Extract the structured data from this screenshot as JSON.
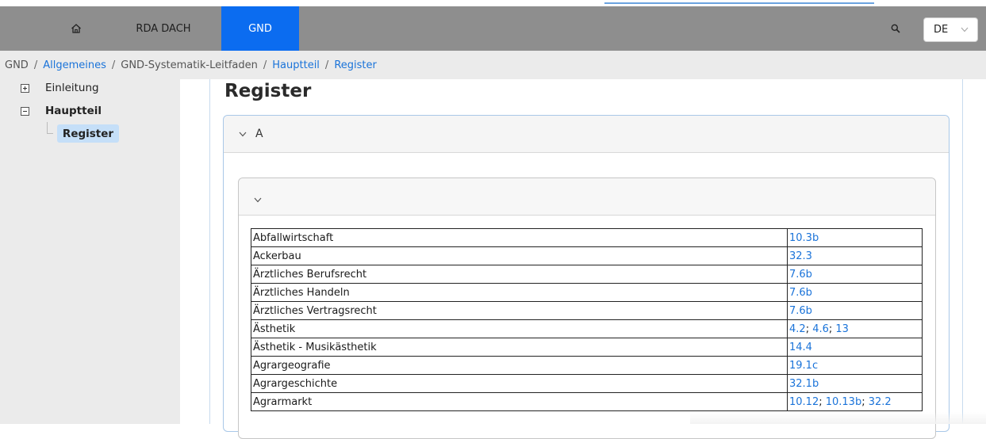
{
  "nav": {
    "home_icon": "home-icon",
    "items": [
      {
        "label": "RDA DACH"
      },
      {
        "label": "GND",
        "active": true
      }
    ],
    "search_icon": "search-icon",
    "language": "DE"
  },
  "breadcrumb": [
    "GND",
    "Allgemeines",
    "GND-Systematik-Leitfaden",
    "Hauptteil",
    "Register"
  ],
  "sidebar": {
    "items": [
      {
        "label": "Einleitung",
        "state": "collapsed"
      },
      {
        "label": "Hauptteil",
        "state": "expanded"
      },
      {
        "label": "Register",
        "active": true
      }
    ]
  },
  "main": {
    "title": "Register",
    "accordion_outer": {
      "label": "A"
    },
    "accordion_inner": {
      "label": ""
    },
    "rows": [
      {
        "term": "Abfallwirtschaft",
        "refs": [
          "10.3b"
        ]
      },
      {
        "term": "Ackerbau",
        "refs": [
          "32.3"
        ]
      },
      {
        "term": "Ärztliches Berufsrecht",
        "refs": [
          "7.6b"
        ]
      },
      {
        "term": "Ärztliches Handeln",
        "refs": [
          "7.6b"
        ]
      },
      {
        "term": "Ärztliches Vertragsrecht",
        "refs": [
          "7.6b"
        ]
      },
      {
        "term": "Ästhetik",
        "refs": [
          "4.2",
          "4.6",
          "13"
        ]
      },
      {
        "term": "Ästhetik - Musikästhetik",
        "refs": [
          "14.4"
        ]
      },
      {
        "term": "Agrargeografie",
        "refs": [
          "19.1c"
        ]
      },
      {
        "term": "Agrargeschichte",
        "refs": [
          "32.1b"
        ]
      },
      {
        "term": "Agrarmarkt",
        "refs": [
          "10.12",
          "10.13b",
          "32.2"
        ]
      }
    ]
  },
  "colors": {
    "nav_bg": "#8e8e8e",
    "nav_active": "#0b6cf0",
    "link": "#1a73d9",
    "sidebar_bg": "#ebebeb",
    "active_item": "#c5dff8"
  }
}
